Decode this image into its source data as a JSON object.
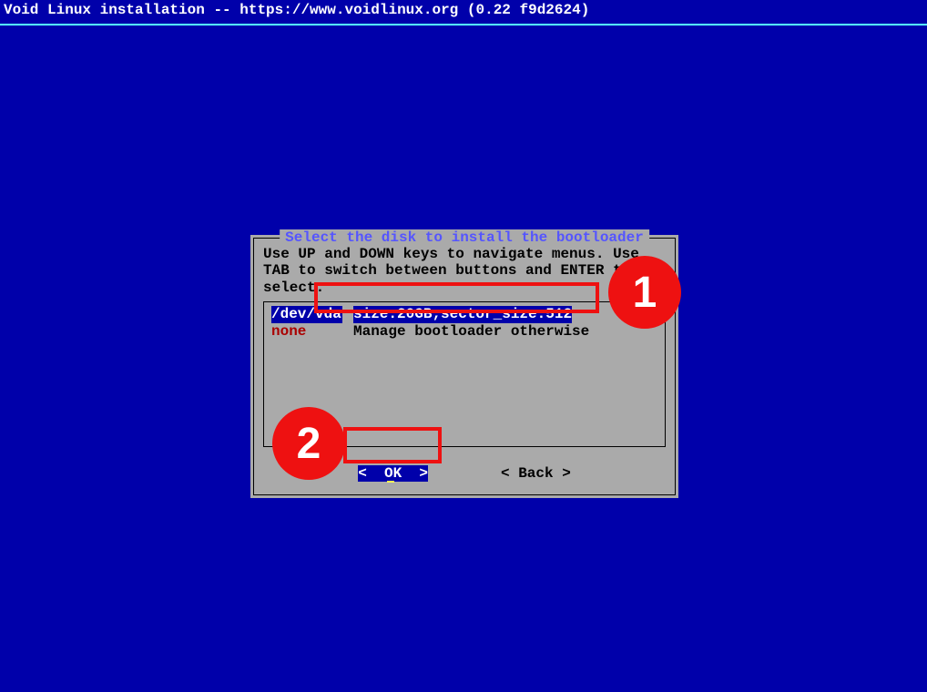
{
  "header": {
    "title": "Void Linux installation -- https://www.voidlinux.org (0.22 f9d2624)"
  },
  "dialog": {
    "title": "Select the disk to install the bootloader",
    "instructions": "Use UP and DOWN keys to navigate menus. Use TAB to switch between buttons and ENTER to select.",
    "items": [
      {
        "dev": "/dev/vda",
        "info": "size:20GB;sector_size:512",
        "selected": true
      },
      {
        "dev": "none",
        "info": "Manage bootloader otherwise",
        "selected": false
      }
    ],
    "buttons": {
      "ok": "<  OK  >",
      "back": "< Back >"
    }
  },
  "annotations": {
    "badge1": "1",
    "badge2": "2"
  }
}
